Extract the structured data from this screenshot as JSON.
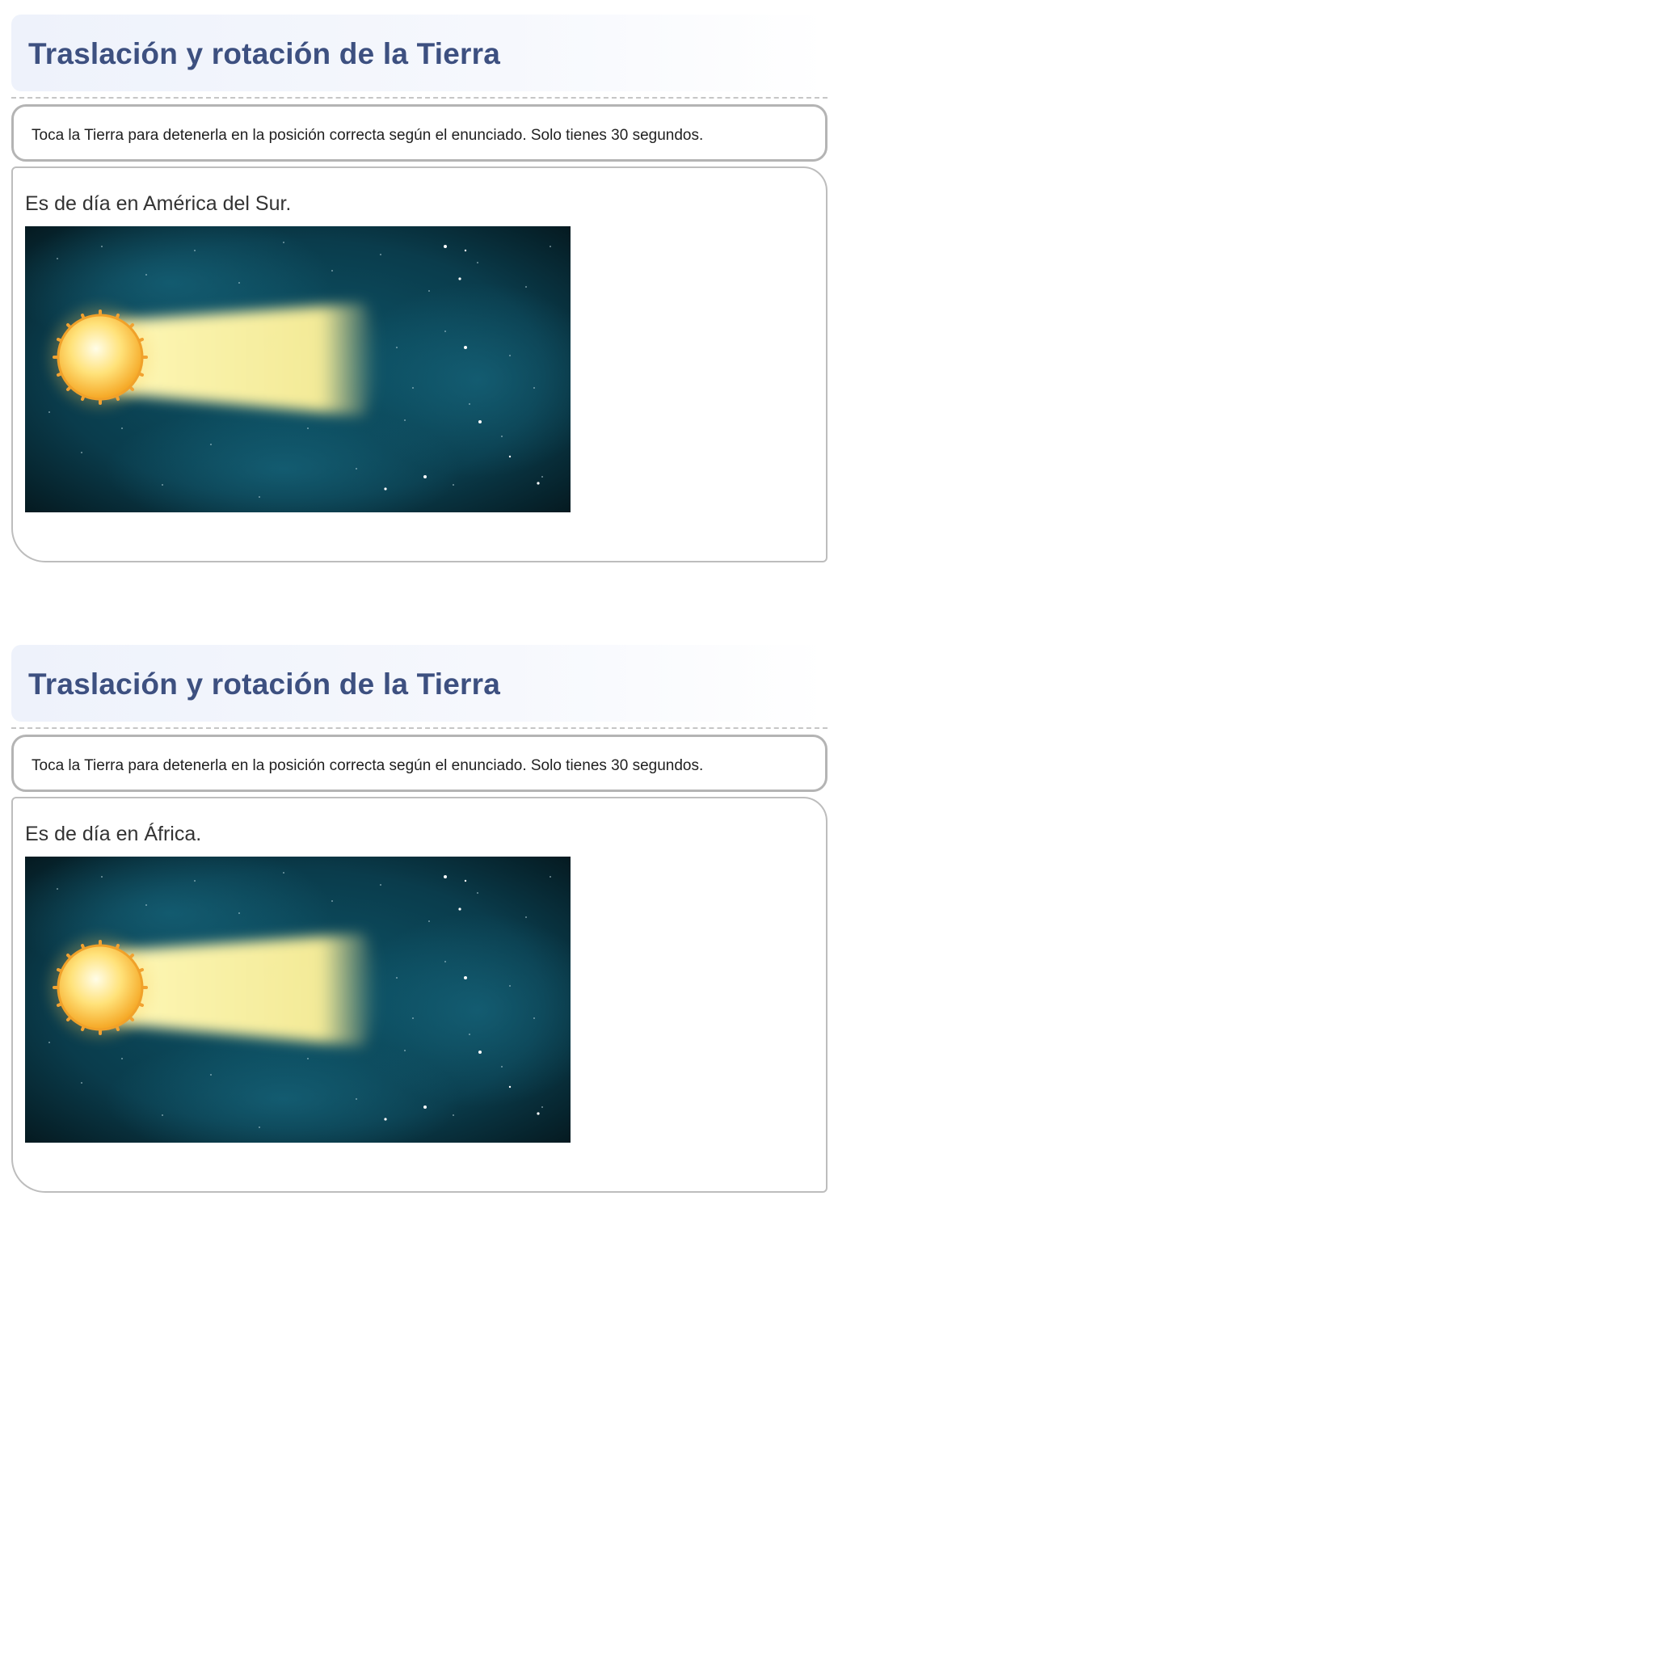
{
  "activities": [
    {
      "title": "Traslación y rotación de la Tierra",
      "instructions": "Toca la Tierra para detenerla en la posición correcta según el enunciado. Solo tienes 30 segundos.",
      "prompt": "Es de día en América del Sur."
    },
    {
      "title": "Traslación y rotación de la Tierra",
      "instructions": "Toca la Tierra para detenerla en la posición correcta según el enunciado. Solo tienes 30 segundos.",
      "prompt": "Es de día en África."
    }
  ],
  "colors": {
    "title": "#3d5080",
    "space_dark": "#061a22",
    "space_mid": "#0b4a5c",
    "sun": "#ffd35a",
    "beam": "#fff3a0"
  },
  "icons": [
    "sun-icon",
    "light-beam"
  ]
}
